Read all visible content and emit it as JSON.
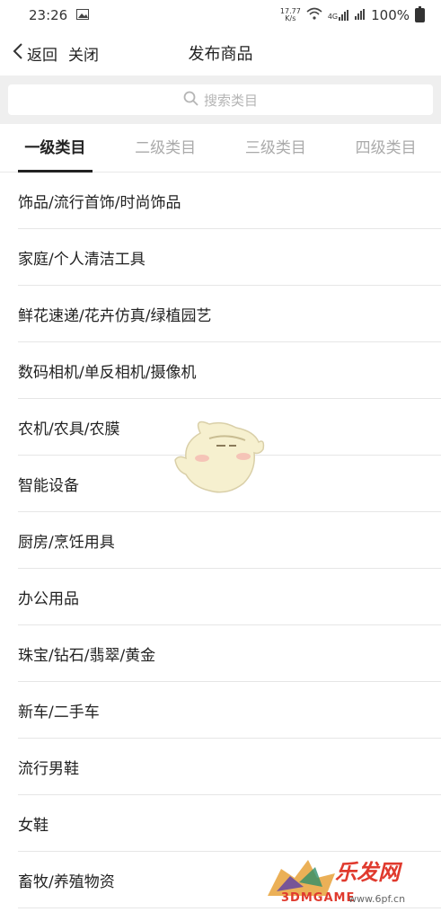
{
  "status_bar": {
    "time": "23:26",
    "speed_top": "17.77",
    "speed_bottom": "K/s",
    "network": "4G",
    "battery": "100%"
  },
  "nav": {
    "back_label": "返回",
    "close_label": "关闭",
    "title": "发布商品"
  },
  "search": {
    "placeholder": "搜索类目"
  },
  "tabs": [
    {
      "label": "一级类目"
    },
    {
      "label": "二级类目"
    },
    {
      "label": "三级类目"
    },
    {
      "label": "四级类目"
    }
  ],
  "categories": [
    {
      "label": "饰品/流行首饰/时尚饰品"
    },
    {
      "label": "家庭/个人清洁工具"
    },
    {
      "label": "鲜花速递/花卉仿真/绿植园艺"
    },
    {
      "label": "数码相机/单反相机/摄像机"
    },
    {
      "label": "农机/农具/农膜"
    },
    {
      "label": "智能设备"
    },
    {
      "label": "厨房/烹饪用具"
    },
    {
      "label": "办公用品"
    },
    {
      "label": "珠宝/钻石/翡翠/黄金"
    },
    {
      "label": "新车/二手车"
    },
    {
      "label": "流行男鞋"
    },
    {
      "label": "女鞋"
    },
    {
      "label": "畜牧/养殖物资"
    }
  ],
  "watermark": {
    "logo_text": "乐发网",
    "sub_text": "3DMGAME",
    "url": "www.6pf.cn"
  },
  "colors": {
    "tab_active": "#222222",
    "tab_inactive": "#aaaaaa",
    "search_bg": "#efefef",
    "watermark_red": "#e03a2e"
  }
}
